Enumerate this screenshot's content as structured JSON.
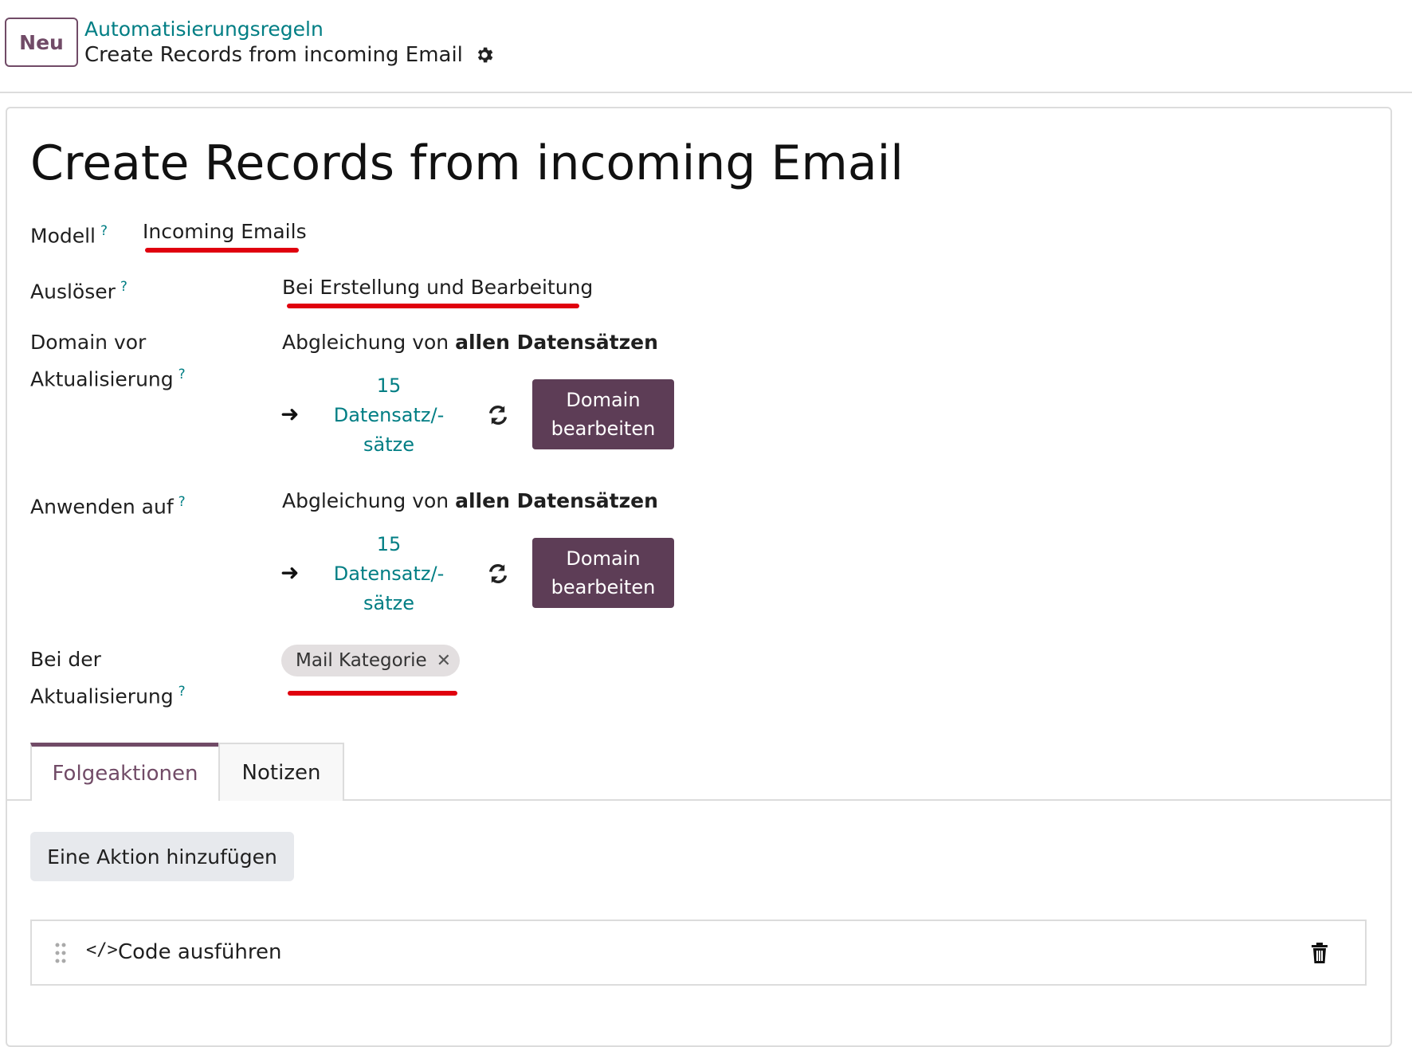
{
  "header": {
    "new_button": "Neu",
    "breadcrumb_parent": "Automatisierungsregeln",
    "breadcrumb_current": "Create Records from incoming Email"
  },
  "form": {
    "title": "Create Records from incoming Email",
    "help_mark": "?",
    "fields": {
      "model": {
        "label": "Modell",
        "value": "Incoming Emails"
      },
      "trigger": {
        "label": "Auslöser",
        "value": "Bei Erstellung und Bearbeitung"
      },
      "domain_before": {
        "label_line1": "Domain vor",
        "label_line2": "Aktualisierung",
        "match_prefix": "Abgleichung von",
        "match_bold": "allen Datensätzen",
        "count_line1": "15",
        "count_line2": "Datensatz/-",
        "count_line3": "sätze",
        "button_line1": "Domain",
        "button_line2": "bearbeiten"
      },
      "apply_on": {
        "label": "Anwenden auf",
        "match_prefix": "Abgleichung von",
        "match_bold": "allen Datensätzen",
        "count_line1": "15",
        "count_line2": "Datensatz/-",
        "count_line3": "sätze",
        "button_line1": "Domain",
        "button_line2": "bearbeiten"
      },
      "on_update": {
        "label_line1": "Bei der",
        "label_line2": "Aktualisierung",
        "tag": "Mail Kategorie"
      }
    }
  },
  "tabs": [
    {
      "label": "Folgeaktionen",
      "active": true
    },
    {
      "label": "Notizen",
      "active": false
    }
  ],
  "actions": {
    "add_button": "Eine Aktion hinzufügen",
    "items": [
      {
        "label": "Code ausführen",
        "icon": "code-icon"
      }
    ]
  },
  "colors": {
    "brand": "#714b67",
    "link": "#017e84",
    "button_dark": "#5d3d56",
    "annotation_red": "#e0000e"
  }
}
